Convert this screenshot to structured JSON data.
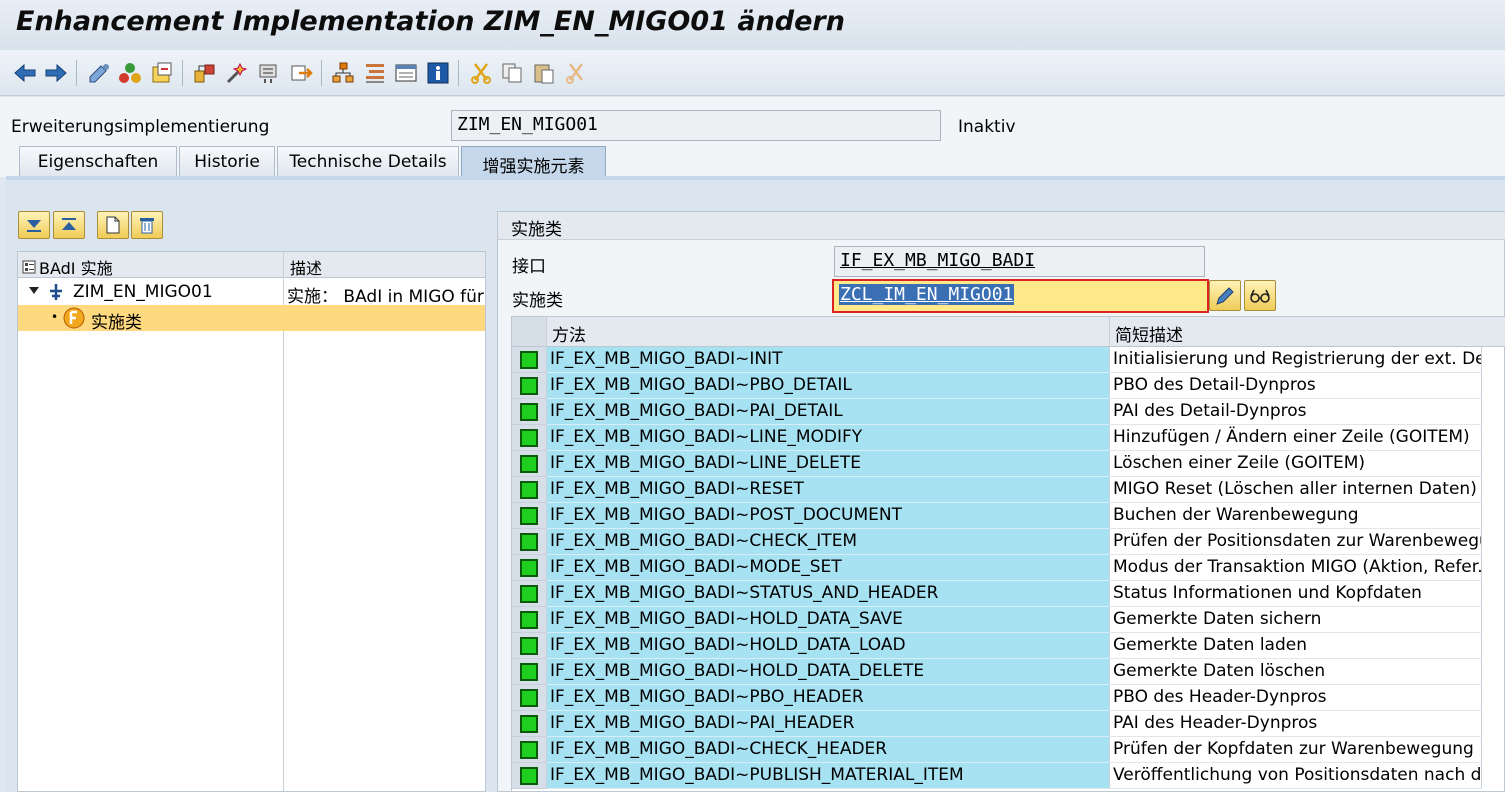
{
  "window": {
    "title": "Enhancement Implementation ZIM_EN_MIGO01 ändern"
  },
  "toolbar": {
    "icons": [
      "back-icon",
      "forward-icon",
      "other-object-icon",
      "check-icon",
      "activate-icon",
      "display-change-icon",
      "where-used-icon",
      "wizard-icon",
      "enhancement-icon",
      "transport-icon",
      "hierarchy-icon",
      "navigator-icon",
      "screen-icon",
      "info-icon",
      "cut-icon",
      "copy-icon",
      "paste-icon",
      "undo-cut-icon"
    ]
  },
  "header": {
    "impl_label": "Erweiterungsimplementierung",
    "impl_value": "ZIM_EN_MIGO01",
    "status": "Inaktiv"
  },
  "tabs": [
    {
      "label": "Eigenschaften"
    },
    {
      "label": "Historie"
    },
    {
      "label": "Technische Details"
    },
    {
      "label": "增强实施元素"
    }
  ],
  "tree": {
    "col1": "BAdI 实施",
    "col2": "描述",
    "rows": [
      {
        "label": "ZIM_EN_MIGO01",
        "desc": "实施：  BAdI in MIGO für"
      },
      {
        "label": "实施类",
        "desc": ""
      }
    ]
  },
  "right": {
    "title": "实施类",
    "interface_label": "接口",
    "interface_value": "IF_EX_MB_MIGO_BADI",
    "class_label": "实施类",
    "class_value": "ZCL_IM_EN_MIGO01"
  },
  "grid": {
    "col_method": "方法",
    "col_desc": "简短描述",
    "rows": [
      {
        "method": "IF_EX_MB_MIGO_BADI~INIT",
        "desc": "Initialisierung und Registrierung der ext. Det"
      },
      {
        "method": "IF_EX_MB_MIGO_BADI~PBO_DETAIL",
        "desc": "PBO des Detail-Dynpros"
      },
      {
        "method": "IF_EX_MB_MIGO_BADI~PAI_DETAIL",
        "desc": "PAI des Detail-Dynpros"
      },
      {
        "method": "IF_EX_MB_MIGO_BADI~LINE_MODIFY",
        "desc": "Hinzufügen / Ändern einer Zeile (GOITEM)"
      },
      {
        "method": "IF_EX_MB_MIGO_BADI~LINE_DELETE",
        "desc": "Löschen einer Zeile (GOITEM)"
      },
      {
        "method": "IF_EX_MB_MIGO_BADI~RESET",
        "desc": "MIGO Reset (Löschen aller internen Daten)"
      },
      {
        "method": "IF_EX_MB_MIGO_BADI~POST_DOCUMENT",
        "desc": "Buchen der Warenbewegung"
      },
      {
        "method": "IF_EX_MB_MIGO_BADI~CHECK_ITEM",
        "desc": "Prüfen der Positionsdaten zur Warenbewegu..."
      },
      {
        "method": "IF_EX_MB_MIGO_BADI~MODE_SET",
        "desc": "Modus der Transaktion MIGO (Aktion, Refer..."
      },
      {
        "method": "IF_EX_MB_MIGO_BADI~STATUS_AND_HEADER",
        "desc": "Status Informationen und Kopfdaten"
      },
      {
        "method": "IF_EX_MB_MIGO_BADI~HOLD_DATA_SAVE",
        "desc": "Gemerkte Daten sichern"
      },
      {
        "method": "IF_EX_MB_MIGO_BADI~HOLD_DATA_LOAD",
        "desc": "Gemerkte Daten laden"
      },
      {
        "method": "IF_EX_MB_MIGO_BADI~HOLD_DATA_DELETE",
        "desc": "Gemerkte Daten löschen"
      },
      {
        "method": "IF_EX_MB_MIGO_BADI~PBO_HEADER",
        "desc": "PBO des Header-Dynpros"
      },
      {
        "method": "IF_EX_MB_MIGO_BADI~PAI_HEADER",
        "desc": "PAI des Header-Dynpros"
      },
      {
        "method": "IF_EX_MB_MIGO_BADI~CHECK_HEADER",
        "desc": "Prüfen der Kopfdaten zur Warenbewegung"
      },
      {
        "method": "IF_EX_MB_MIGO_BADI~PUBLISH_MATERIAL_ITEM",
        "desc": "Veröffentlichung von Positionsdaten nach de"
      }
    ]
  },
  "colors": {
    "method_cell": "#a7e2f3",
    "selected_row": "#ffd97f",
    "status_green": "#1fcf1f",
    "error_border": "#dd2222"
  }
}
